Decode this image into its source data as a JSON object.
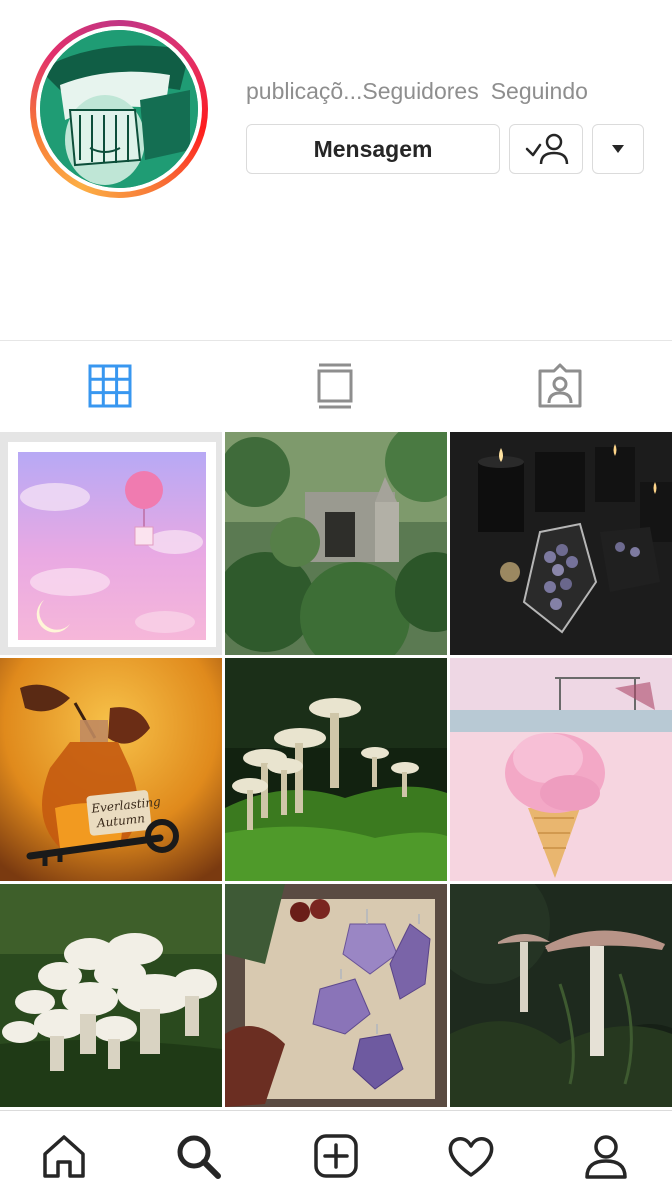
{
  "profile": {
    "stats": [
      {
        "label": "publicaçõ..."
      },
      {
        "label": "Seguidores"
      },
      {
        "label": "Seguindo"
      }
    ],
    "message_button": "Mensagem",
    "follow_icon": "person-check-icon",
    "more_icon": "caret-down-icon"
  },
  "tabs": [
    {
      "name": "grid",
      "icon": "grid-icon",
      "active": true
    },
    {
      "name": "feed",
      "icon": "feed-icon",
      "active": false
    },
    {
      "name": "tagged",
      "icon": "tagged-icon",
      "active": false
    }
  ],
  "posts": [
    {
      "label": "Pastel sky with balloon"
    },
    {
      "label": "Overgrown ruins"
    },
    {
      "label": "Candles and amethyst coffin"
    },
    {
      "label": "Everlasting Autumn"
    },
    {
      "label": "Mushrooms in moss"
    },
    {
      "label": "Pink ice cream cone"
    },
    {
      "label": "White mushrooms cluster"
    },
    {
      "label": "Amethyst crystals"
    },
    {
      "label": "Tall mushroom in dark forest"
    }
  ],
  "bottle_label_line1": "Everlasting",
  "bottle_label_line2": "Autumn",
  "bottom_nav": [
    {
      "name": "home",
      "icon": "home-icon"
    },
    {
      "name": "search",
      "icon": "search-icon",
      "active": true
    },
    {
      "name": "new-post",
      "icon": "plus-square-icon"
    },
    {
      "name": "activity",
      "icon": "heart-icon"
    },
    {
      "name": "profile",
      "icon": "person-icon"
    }
  ],
  "colors": {
    "active_tab": "#3897f0",
    "inactive": "#8e8e8e",
    "avatar_bg": "#1f9c74"
  }
}
